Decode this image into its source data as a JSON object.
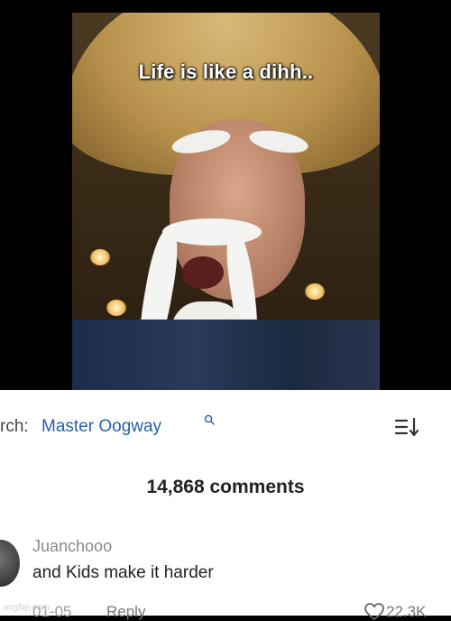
{
  "video": {
    "caption": "Life is like a dihh.."
  },
  "comments_panel": {
    "search_prefix": "rch:",
    "search_term": "Master Oogway",
    "comments_count": "14,868 comments",
    "comment": {
      "username": "Juanchooo",
      "text": "and Kids make it harder",
      "timestamp": "01-05",
      "reply_label": "Reply",
      "like_count": "22.3K"
    }
  },
  "watermark": "imgflip.com",
  "colors": {
    "search_term": "#2a5fa8",
    "username": "#8a8a8a",
    "muted": "#777777"
  },
  "icons": {
    "search": "search-icon",
    "sort": "sort-icon",
    "like": "heart-icon"
  }
}
